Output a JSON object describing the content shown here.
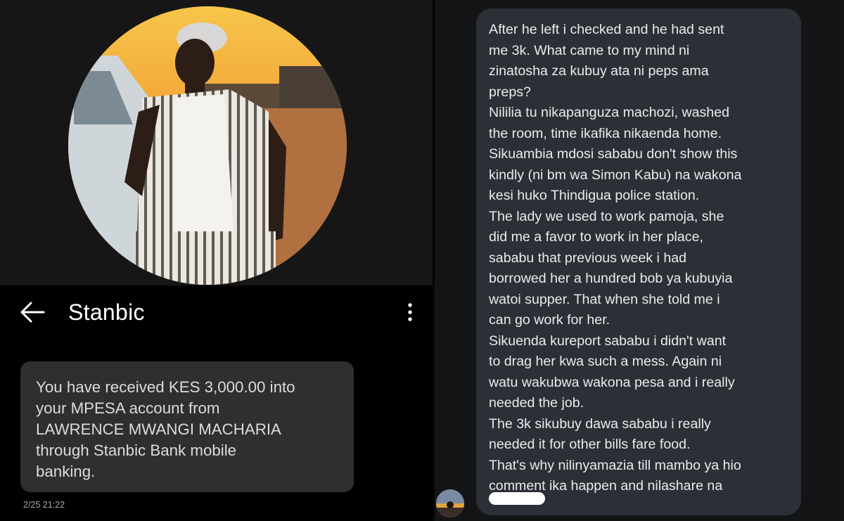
{
  "sms_screen": {
    "app_bar": {
      "title": "Stanbic",
      "back_icon": "arrow-left-icon",
      "menu_icon": "more-vertical-icon"
    },
    "message": {
      "lines": [
        "You have received KES 3,000.00 into",
        "your MPESA account from",
        "LAWRENCE MWANGI MACHARIA",
        "through Stanbic Bank mobile",
        "banking."
      ],
      "timestamp": "2/25 21:22"
    }
  },
  "comment_screen": {
    "comment_lines": [
      "After he left i checked and he had sent",
      "me 3k. What came to my mind ni",
      "zinatosha za kubuy ata  ni peps ama",
      "preps?",
      "Nililia tu nikapanguza machozi, washed",
      "the room, time ikafika nikaenda home.",
      "Sikuambia mdosi sababu don't show this",
      "kindly (ni bm wa Simon Kabu) na wakona",
      "kesi huko Thindigua police station.",
      "The lady we used to work pamoja, she",
      "did me a favor to work in her place,",
      "sababu that previous week i had",
      "borrowed her a hundred bob ya kubuyia",
      "watoi supper. That when she told me i",
      "can go work for her.",
      "Sikuenda kureport sababu i didn't want",
      "to drag her kwa such a mess. Again ni",
      "watu wakubwa wakona pesa and i really",
      "needed the job.",
      "The 3k sikubuy dawa sababu i really",
      "needed it for other bills fare food.",
      "That's why nilinyamazia till mambo ya hio",
      "comment ika happen and nilashare na"
    ]
  },
  "colors": {
    "sms_bubble": "#2f2f2f",
    "comment_bubble": "#2c2f35",
    "comment_background": "#131416"
  }
}
